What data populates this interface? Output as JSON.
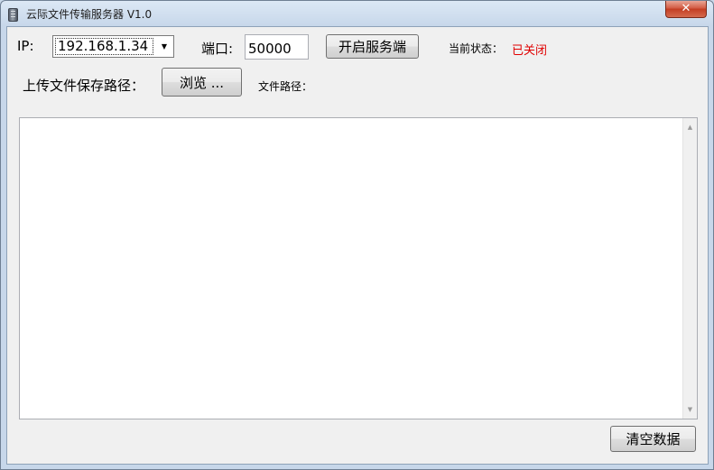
{
  "window": {
    "title": "云际文件传输服务器 V1.0",
    "close_label": "✕"
  },
  "server": {
    "ip_label": "IP:",
    "ip_value": "192.168.1.34",
    "port_label": "端口:",
    "port_value": "50000",
    "start_button": "开启服务端",
    "status_label": "当前状态：",
    "status_value": "已关闭",
    "status_color": "#e00000"
  },
  "upload": {
    "path_label": "上传文件保存路径：",
    "browse_button": "浏览 ...",
    "file_path_label": "文件路径："
  },
  "log": {
    "content": ""
  },
  "actions": {
    "clear_button": "清空数据"
  }
}
